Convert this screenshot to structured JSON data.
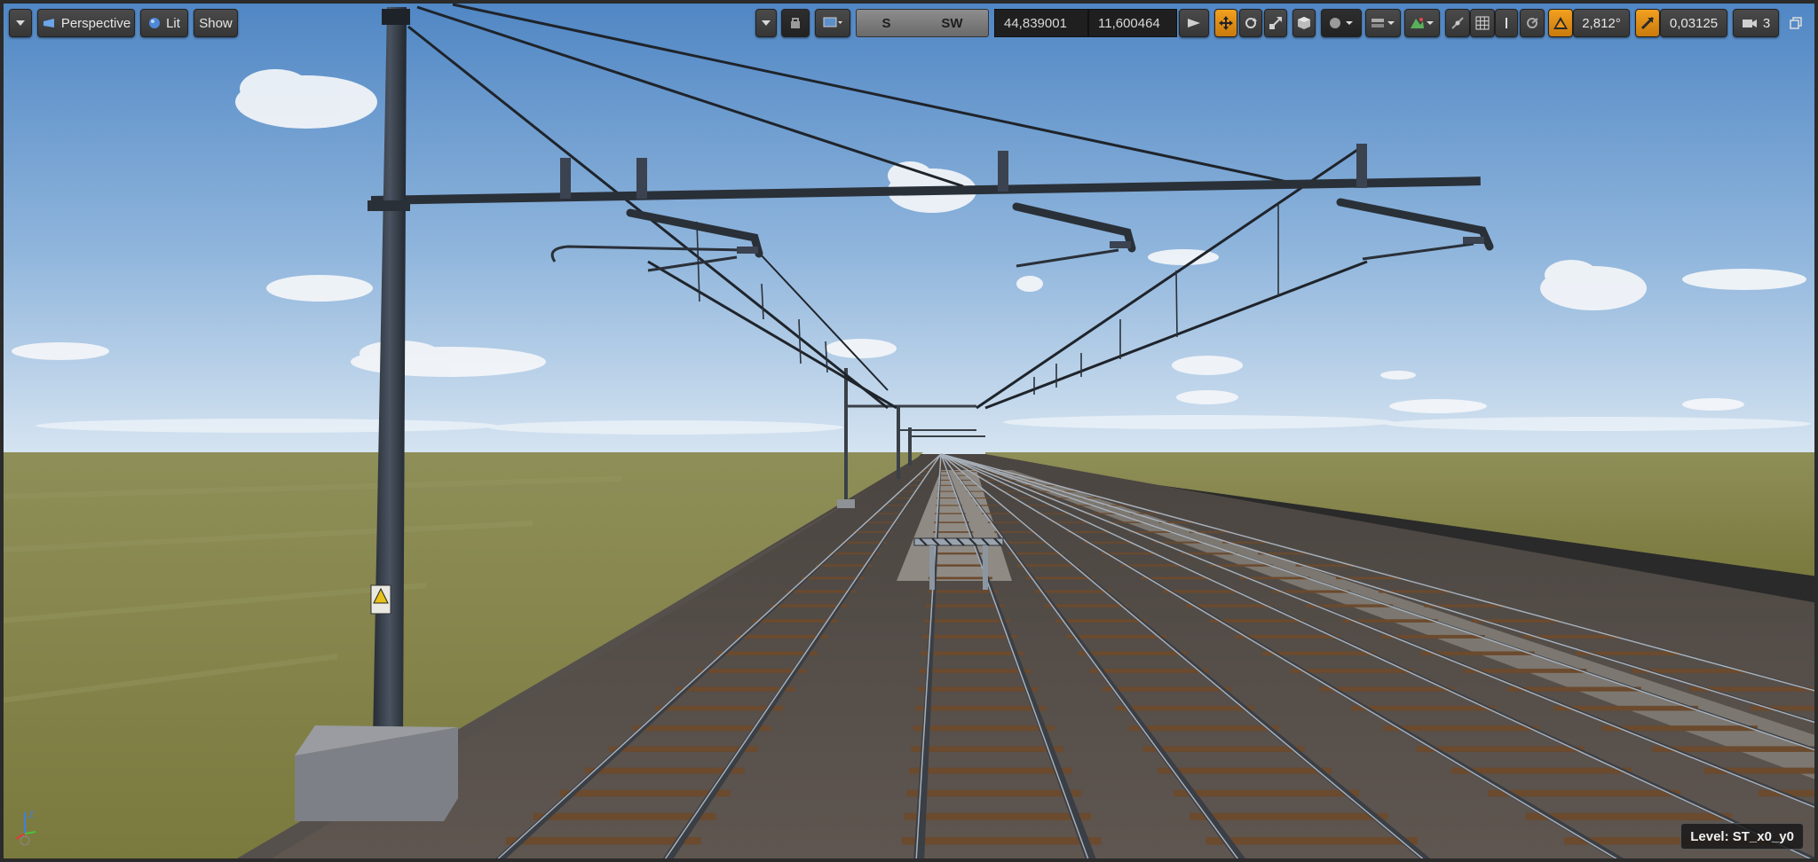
{
  "toolbar": {
    "viewport_options_icon": "chevron-down-icon",
    "perspective_label": "Perspective",
    "lit_label": "Lit",
    "show_label": "Show",
    "compass_labels": [
      "S",
      "SW"
    ],
    "coord_x": "44,839001",
    "coord_y": "11,600464",
    "rotation_snap_value": "2,812°",
    "scale_snap_value": "0,03125",
    "camera_speed_value": "3",
    "accent_color": "#e8961a"
  },
  "status": {
    "level_prefix": "Level:",
    "level_name": "ST_x0_y0"
  },
  "axis_widget": {
    "z_label": "Z",
    "colors": {
      "x": "#e23b3b",
      "y": "#49c43e",
      "z": "#3f7ee8"
    }
  },
  "scene": {
    "sky_top": "#5b8fc9",
    "sky_horizon": "#c9dcee",
    "grass_color": "#8a8a4e",
    "ballast_color": "#5e5650",
    "rail_color": "#3c3f45",
    "sleeper_color": "#6b4a2e",
    "mast_color": "#2c323a"
  }
}
